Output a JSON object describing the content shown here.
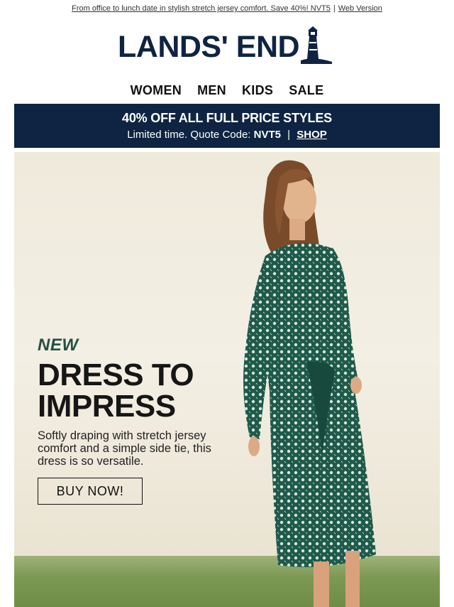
{
  "preheader": {
    "text": "From office to lunch date in stylish stretch jersey comfort. Save 40%! NVT5",
    "separator": "|",
    "web_version": "Web Version"
  },
  "logo": {
    "text": "LANDS' END",
    "icon": "lighthouse-icon"
  },
  "nav": [
    "WOMEN",
    "MEN",
    "KIDS",
    "SALE"
  ],
  "promo": {
    "headline": "40% OFF ALL FULL PRICE STYLES",
    "sub_prefix": "Limited time. Quote Code:",
    "code": "NVT5",
    "separator": "|",
    "shop": "SHOP",
    "background": "#0f2442"
  },
  "hero": {
    "new_label": "NEW",
    "title_line1": "DRESS TO",
    "title_line2": "IMPRESS",
    "description": "Softly draping with stretch jersey comfort and a simple side tie, this dress is so versatile.",
    "cta": "BUY NOW!",
    "accent": "#264f46"
  },
  "colors": {
    "brand_navy": "#0f2442",
    "dress_green": "#1f5a4a"
  }
}
